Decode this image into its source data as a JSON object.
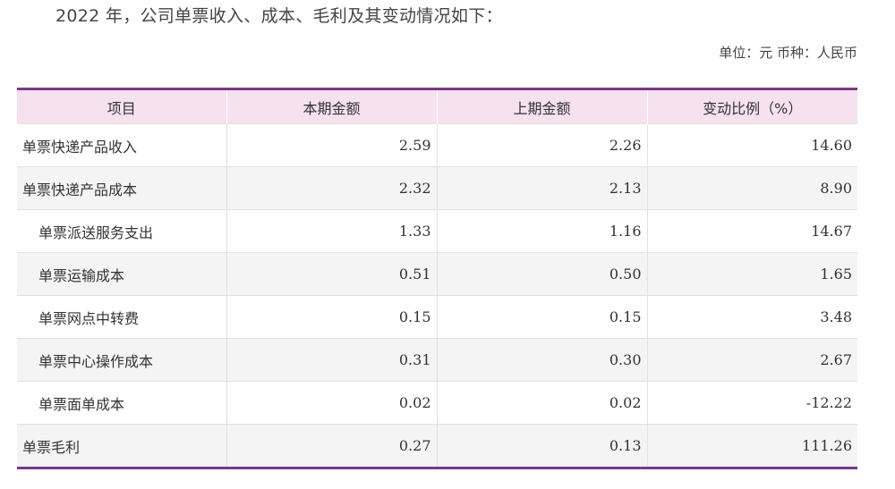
{
  "intro": "2022 年，公司单票收入、成本、毛利及其变动情况如下：",
  "unit": "单位：元  币种：人民币",
  "table": {
    "headers": [
      "项目",
      "本期金额",
      "上期金额",
      "变动比例（%）"
    ],
    "rows": [
      {
        "item": "单票快递产品收入",
        "current": "2.59",
        "previous": "2.26",
        "change": "14.60"
      },
      {
        "item": "单票快递产品成本",
        "current": "2.32",
        "previous": "2.13",
        "change": "8.90"
      },
      {
        "item": "单票派送服务支出",
        "current": "1.33",
        "previous": "1.16",
        "change": "14.67"
      },
      {
        "item": "单票运输成本",
        "current": "0.51",
        "previous": "0.50",
        "change": "1.65"
      },
      {
        "item": "单票网点中转费",
        "current": "0.15",
        "previous": "0.15",
        "change": "3.48"
      },
      {
        "item": "单票中心操作成本",
        "current": "0.31",
        "previous": "0.30",
        "change": "2.67"
      },
      {
        "item": "单票面单成本",
        "current": "0.02",
        "previous": "0.02",
        "change": "-12.22"
      },
      {
        "item": "单票毛利",
        "current": "0.27",
        "previous": "0.13",
        "change": "111.26"
      }
    ]
  }
}
